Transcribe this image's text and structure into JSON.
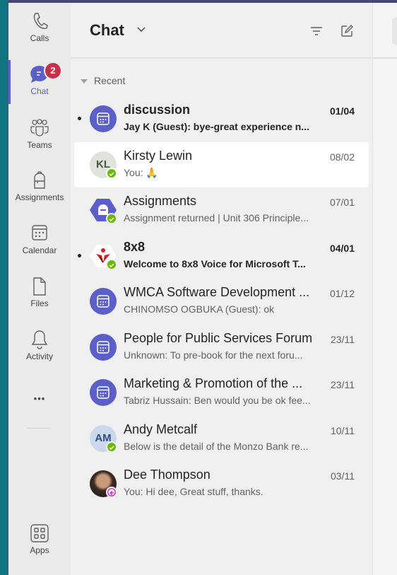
{
  "rail": {
    "items": [
      {
        "label": "Calls",
        "icon": "phone-icon"
      },
      {
        "label": "Chat",
        "icon": "chat-icon",
        "badge": "2",
        "active": true
      },
      {
        "label": "Teams",
        "icon": "teams-icon"
      },
      {
        "label": "Assignments",
        "icon": "backpack-icon"
      },
      {
        "label": "Calendar",
        "icon": "calendar-icon"
      },
      {
        "label": "Files",
        "icon": "file-icon"
      },
      {
        "label": "Activity",
        "icon": "bell-icon"
      }
    ],
    "more": "•••",
    "apps": "Apps"
  },
  "header": {
    "title": "Chat"
  },
  "section": "Recent",
  "colors": {
    "accent": "#5b5fc7",
    "online": "#6bb700",
    "badge": "#c4314b",
    "away": "#c239b3"
  },
  "chats": [
    {
      "name": "discussion",
      "date": "01/04",
      "msg": "Jay K (Guest): bye-great experience n...",
      "unread": true,
      "avatar": "meeting"
    },
    {
      "name": "Kirsty Lewin",
      "date": "08/02",
      "msg": "You: 🙏",
      "initials": "KL",
      "avatar": "initials",
      "selected": true,
      "presence": "online"
    },
    {
      "name": "Assignments",
      "date": "07/01",
      "msg": "Assignment returned | Unit 306 Principle...",
      "avatar": "assignments",
      "presence": "online"
    },
    {
      "name": "8x8",
      "date": "04/01",
      "msg": "Welcome to 8x8 Voice for Microsoft T...",
      "unread": true,
      "avatar": "8x8",
      "presence": "online"
    },
    {
      "name": "WMCA Software Development ...",
      "date": "01/12",
      "msg": "CHINOMSO OGBUKA (Guest): ok",
      "avatar": "meeting"
    },
    {
      "name": "People for Public Services Forum",
      "date": "23/11",
      "msg": "Unknown: To pre-book for the next foru...",
      "avatar": "meeting"
    },
    {
      "name": "Marketing & Promotion of the ...",
      "date": "23/11",
      "msg": "Tabriz Hussain: Ben would you be ok fee...",
      "avatar": "meeting"
    },
    {
      "name": "Andy Metcalf",
      "date": "10/11",
      "msg": "Below is the detail of the Monzo Bank re...",
      "initials": "AM",
      "avatar": "initials2",
      "presence": "online"
    },
    {
      "name": "Dee Thompson",
      "date": "03/11",
      "msg": "You: Hi dee, Great stuff, thanks.",
      "avatar": "photo",
      "presence": "away"
    }
  ]
}
